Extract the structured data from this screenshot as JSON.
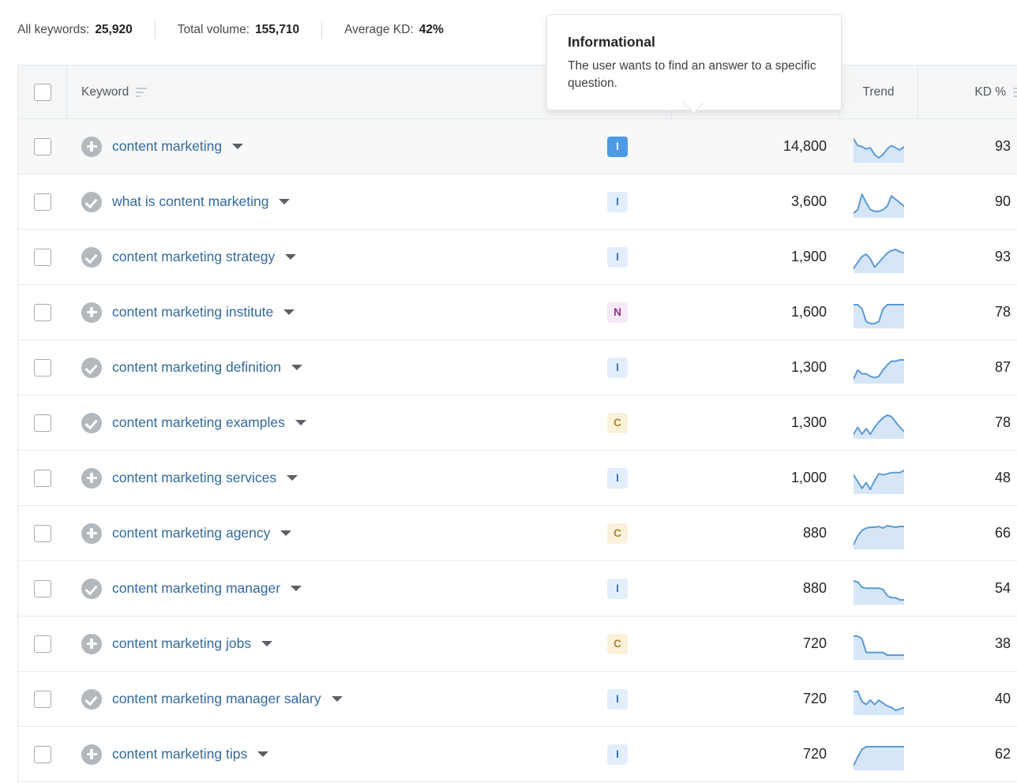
{
  "summary": {
    "items": [
      {
        "label": "All keywords:",
        "value": "25,920"
      },
      {
        "label": "Total volume:",
        "value": "155,710"
      },
      {
        "label": "Average KD:",
        "value": "42%"
      }
    ]
  },
  "tooltip": {
    "title": "Informational",
    "body": "The user wants to find an answer to a specific question."
  },
  "table": {
    "columns": {
      "keyword": "Keyword",
      "trend": "Trend",
      "kd": "KD %"
    },
    "rows": [
      {
        "keyword": "content marketing",
        "icon": "plus",
        "intent": "I",
        "intent_selected": true,
        "volume": "14,800",
        "kd": "93",
        "kd_color": "#8c1414",
        "trend": [
          58,
          46,
          44,
          40,
          42,
          30,
          24,
          30,
          40,
          46,
          42,
          38,
          44
        ],
        "selected": true
      },
      {
        "keyword": "what is content marketing",
        "icon": "check",
        "intent": "I",
        "intent_selected": false,
        "volume": "3,600",
        "kd": "90",
        "kd_color": "#8c1414",
        "trend": [
          36,
          40,
          58,
          48,
          40,
          38,
          38,
          40,
          44,
          56,
          52,
          48,
          44
        ]
      },
      {
        "keyword": "content marketing strategy",
        "icon": "check",
        "intent": "I",
        "intent_selected": false,
        "volume": "1,900",
        "kd": "93",
        "kd_color": "#8c1414",
        "trend": [
          30,
          40,
          50,
          54,
          46,
          32,
          40,
          48,
          56,
          60,
          62,
          58,
          56
        ]
      },
      {
        "keyword": "content marketing institute",
        "icon": "plus",
        "intent": "N",
        "intent_selected": false,
        "volume": "1,600",
        "kd": "78",
        "kd_color": "#e1413c",
        "trend": [
          44,
          44,
          40,
          28,
          26,
          26,
          28,
          40,
          44,
          44,
          44,
          44,
          44
        ]
      },
      {
        "keyword": "content marketing definition",
        "icon": "check",
        "intent": "I",
        "intent_selected": false,
        "volume": "1,300",
        "kd": "87",
        "kd_color": "#8c1414",
        "trend": [
          26,
          40,
          34,
          34,
          30,
          28,
          30,
          40,
          48,
          54,
          54,
          56,
          56
        ]
      },
      {
        "keyword": "content marketing examples",
        "icon": "check",
        "intent": "C",
        "intent_selected": false,
        "volume": "1,300",
        "kd": "78",
        "kd_color": "#e1413c",
        "trend": [
          30,
          40,
          30,
          38,
          30,
          40,
          48,
          54,
          58,
          56,
          48,
          40,
          34
        ]
      },
      {
        "keyword": "content marketing services",
        "icon": "plus",
        "intent": "I",
        "intent_selected": false,
        "volume": "1,000",
        "kd": "48",
        "kd_color": "#f2c033",
        "trend": [
          50,
          38,
          26,
          36,
          24,
          40,
          52,
          50,
          52,
          54,
          54,
          54,
          58
        ]
      },
      {
        "keyword": "content marketing agency",
        "icon": "plus",
        "intent": "C",
        "intent_selected": false,
        "volume": "880",
        "kd": "66",
        "kd_color": "#ef8435",
        "trend": [
          12,
          34,
          48,
          54,
          56,
          56,
          58,
          54,
          60,
          58,
          56,
          58,
          58
        ]
      },
      {
        "keyword": "content marketing manager",
        "icon": "check",
        "intent": "I",
        "intent_selected": false,
        "volume": "880",
        "kd": "54",
        "kd_color": "#ef8435",
        "trend": [
          58,
          56,
          46,
          44,
          44,
          44,
          44,
          42,
          30,
          26,
          26,
          22,
          22
        ]
      },
      {
        "keyword": "content marketing jobs",
        "icon": "plus",
        "intent": "C",
        "intent_selected": false,
        "volume": "720",
        "kd": "38",
        "kd_color": "#f2c033",
        "trend": [
          40,
          40,
          38,
          28,
          28,
          28,
          28,
          28,
          26,
          26,
          26,
          26,
          26
        ]
      },
      {
        "keyword": "content marketing manager salary",
        "icon": "check",
        "intent": "I",
        "intent_selected": false,
        "volume": "720",
        "kd": "40",
        "kd_color": "#f2c033",
        "trend": [
          52,
          52,
          38,
          34,
          40,
          34,
          40,
          36,
          32,
          30,
          26,
          28,
          30
        ]
      },
      {
        "keyword": "content marketing tips",
        "icon": "plus",
        "intent": "I",
        "intent_selected": false,
        "volume": "720",
        "kd": "62",
        "kd_color": "#ef8435",
        "trend": [
          14,
          34,
          52,
          58,
          58,
          58,
          58,
          58,
          58,
          58,
          58,
          58,
          58
        ]
      }
    ]
  }
}
